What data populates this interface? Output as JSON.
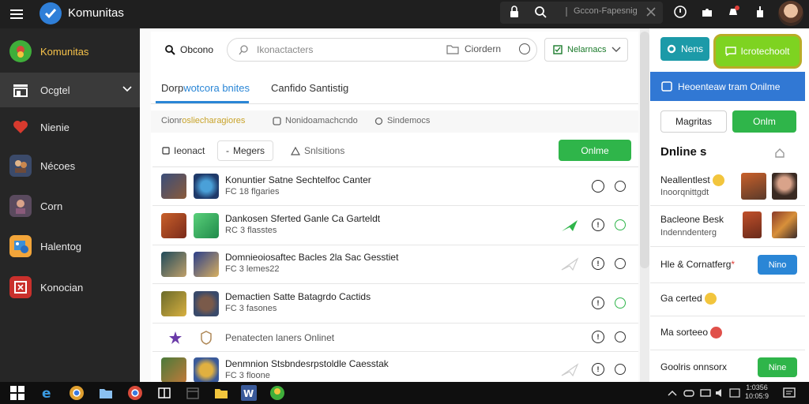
{
  "app": {
    "title": "Komunitas"
  },
  "titlebar": {
    "search_text": "Gccon-Fapesnig"
  },
  "sidebar": {
    "items": [
      {
        "label": "Komunitas",
        "icon": "community-icon"
      },
      {
        "label": "Ocgtel",
        "icon": "store-icon"
      },
      {
        "label": "Nienie",
        "icon": "heart-icon"
      },
      {
        "label": "Nécoes",
        "icon": "people-icon"
      },
      {
        "label": "Corn",
        "icon": "profile-icon"
      },
      {
        "label": "Halentog",
        "icon": "gallery-icon"
      },
      {
        "label": "Konocian",
        "icon": "settings-icon"
      }
    ]
  },
  "toolbar": {
    "obcono": "Obcono",
    "search_placeholder": "Ikonactacters",
    "ciordern": "Ciordern",
    "notif_label": "Nelarnacs"
  },
  "tabs": [
    {
      "prefix": "Dorp",
      "highlight": "wotcora bnites"
    },
    {
      "label": "Canfido Santistig"
    }
  ],
  "filters": [
    {
      "plain": "Cionr",
      "highlight": "osliecharagiores"
    },
    {
      "label": "Nonidoamachcndo"
    },
    {
      "label": "Sindemocs"
    }
  ],
  "subtabs": [
    {
      "label": "Ieonact"
    },
    {
      "label": "Megers"
    },
    {
      "label": "Snlsitions"
    }
  ],
  "online_button": "Onlme",
  "list": [
    {
      "title": "Konuntier Satne Sechtelfoc Canter",
      "sub": "FC 18 flgaries",
      "circ2": "plain",
      "send": false
    },
    {
      "title": "Dankosen Sferted Ganle Ca Garteldt",
      "sub": "RC 3 flasstes",
      "circ2": "green",
      "send": true
    },
    {
      "title": "Domnieoiosaftec Bacles 2la Sac Gesstiet",
      "sub": "FC 3 lemes22",
      "circ2": "plain",
      "send": true
    },
    {
      "title": "Demactien Satte Batagrdo Cactids",
      "sub": "FC 3 fasones",
      "circ2": "green",
      "send": false
    },
    {
      "title": "Penatecten laners Onlinet",
      "sub": "",
      "circ2": "plain",
      "send": false
    },
    {
      "title": "Denmnion Stsbndesrpstoldle Caesstak",
      "sub": "FC 3 floone",
      "circ2": "plain",
      "send": true
    }
  ],
  "right": {
    "news_label": "Nens",
    "cta_label": "Icrotechoolt",
    "banner": "Heoenteaw tram Onilme",
    "btn_magritas": "Magritas",
    "btn_onlm": "Onlm",
    "online_heading": "Dnline s",
    "entries": [
      {
        "name": "Neallentlest",
        "sub": "Inoorqnittgdt"
      },
      {
        "name": "Bacleone Besk",
        "sub": "Indenndenterg"
      },
      {
        "name": "Hle & Cornatferg",
        "btn": "Nino"
      },
      {
        "name": "Ga certed"
      },
      {
        "name": "Ma sorteeo"
      },
      {
        "name": "Goolris onnsorx",
        "btn": "Nine"
      }
    ]
  },
  "taskbar": {
    "time": "1:0356",
    "date": "10:05:9"
  },
  "colors": {
    "accent_blue": "#2a86d6",
    "accent_green": "#2fb54a",
    "cta_green": "#7ed321",
    "banner_blue": "#3178d4",
    "teal": "#1c9aa8"
  }
}
